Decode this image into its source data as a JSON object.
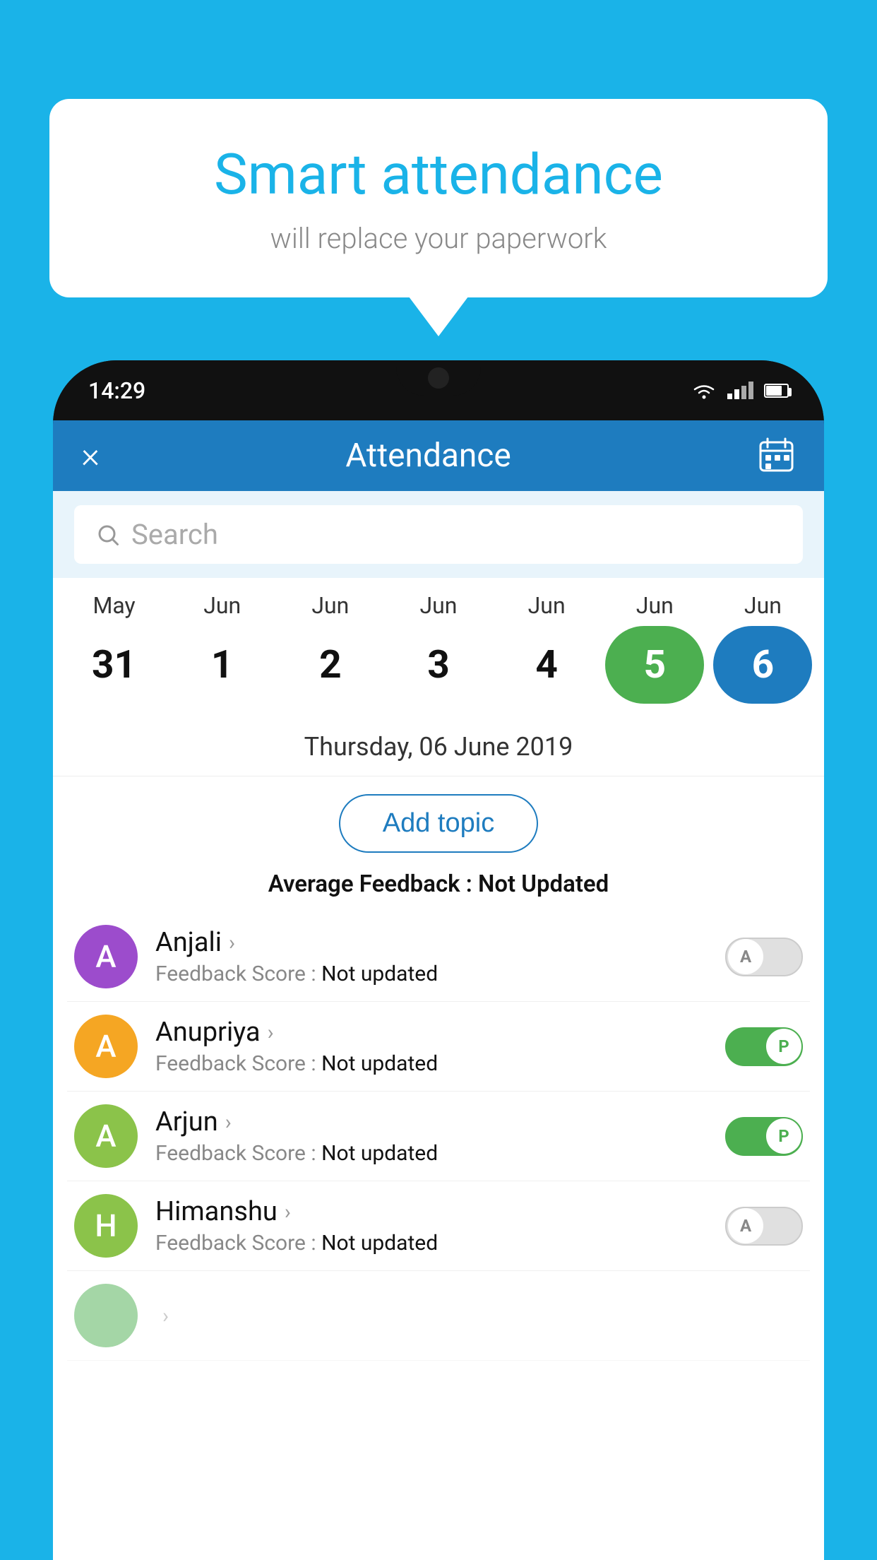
{
  "background_color": "#1ab3e8",
  "bubble": {
    "title": "Smart attendance",
    "subtitle": "will replace your paperwork"
  },
  "phone": {
    "time": "14:29",
    "header": {
      "title": "Attendance",
      "close_label": "×",
      "calendar_icon": "calendar-icon"
    },
    "search": {
      "placeholder": "Search"
    },
    "calendar": {
      "months": [
        "May",
        "Jun",
        "Jun",
        "Jun",
        "Jun",
        "Jun",
        "Jun"
      ],
      "dates": [
        {
          "day": "31",
          "state": "normal"
        },
        {
          "day": "1",
          "state": "normal"
        },
        {
          "day": "2",
          "state": "normal"
        },
        {
          "day": "3",
          "state": "normal"
        },
        {
          "day": "4",
          "state": "normal"
        },
        {
          "day": "5",
          "state": "green"
        },
        {
          "day": "6",
          "state": "blue"
        }
      ],
      "selected_date": "Thursday, 06 June 2019"
    },
    "add_topic_label": "Add topic",
    "avg_feedback_label": "Average Feedback :",
    "avg_feedback_value": "Not Updated",
    "students": [
      {
        "name": "Anjali",
        "avatar_letter": "A",
        "avatar_color": "#9c4ccc",
        "feedback_label": "Feedback Score :",
        "feedback_value": "Not updated",
        "toggle_state": "off",
        "toggle_label": "A"
      },
      {
        "name": "Anupriya",
        "avatar_letter": "A",
        "avatar_color": "#f5a623",
        "feedback_label": "Feedback Score :",
        "feedback_value": "Not updated",
        "toggle_state": "on",
        "toggle_label": "P"
      },
      {
        "name": "Arjun",
        "avatar_letter": "A",
        "avatar_color": "#8bc34a",
        "feedback_label": "Feedback Score :",
        "feedback_value": "Not updated",
        "toggle_state": "on",
        "toggle_label": "P"
      },
      {
        "name": "Himanshu",
        "avatar_letter": "H",
        "avatar_color": "#8bc34a",
        "feedback_label": "Feedback Score :",
        "feedback_value": "Not updated",
        "toggle_state": "off",
        "toggle_label": "A"
      }
    ]
  }
}
